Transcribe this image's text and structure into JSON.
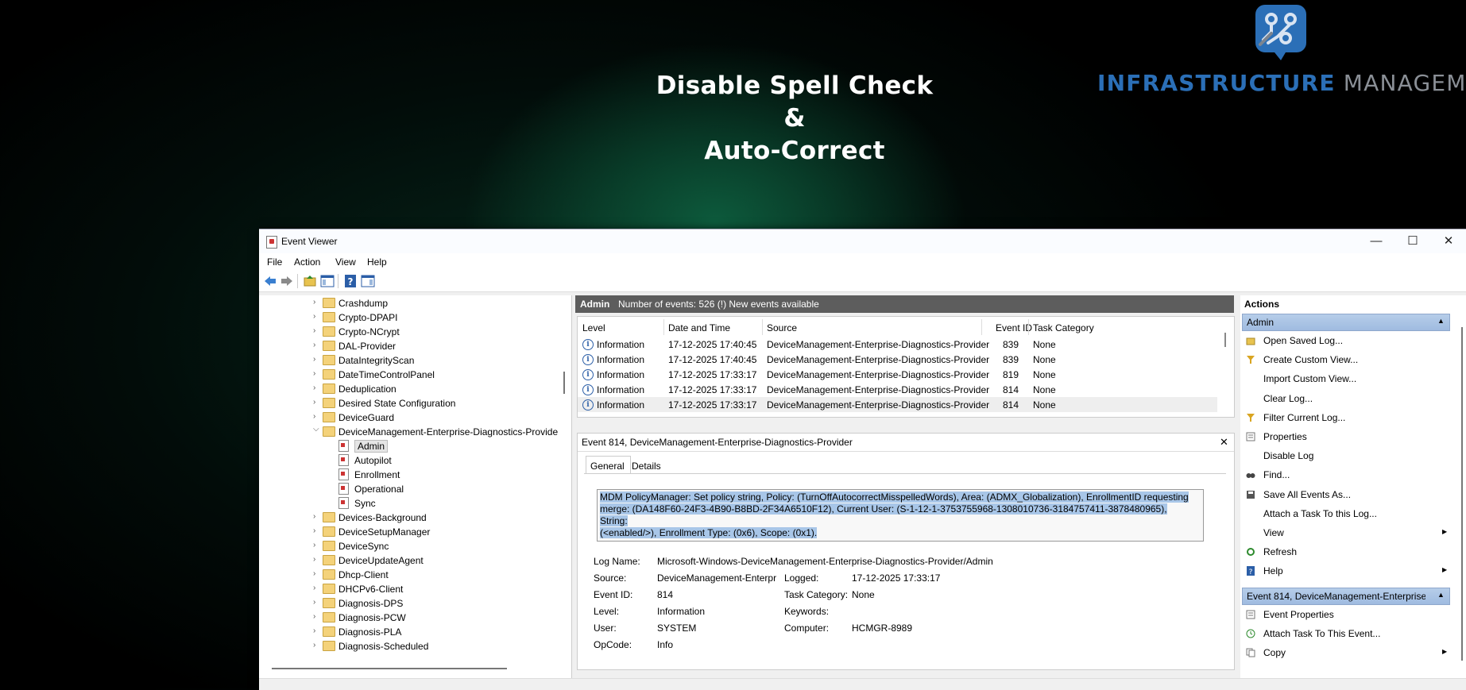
{
  "banner": {
    "headline_line1": "Disable Spell Check &",
    "headline_line2": "Auto-Correct",
    "logo_bold": "INFRASTRUCTURE",
    "logo_light": " MANAGEMENT",
    "logo_icon": "circuit-chat-bubble-icon"
  },
  "window": {
    "title": "Event Viewer",
    "menu": [
      "File",
      "Action",
      "View",
      "Help"
    ],
    "minimize": "—",
    "maximize": "☐",
    "close": "✕"
  },
  "tree": [
    {
      "label": "Crashdump",
      "type": "folder",
      "expanded": false
    },
    {
      "label": "Crypto-DPAPI",
      "type": "folder",
      "expanded": false
    },
    {
      "label": "Crypto-NCrypt",
      "type": "folder",
      "expanded": false
    },
    {
      "label": "DAL-Provider",
      "type": "folder",
      "expanded": false
    },
    {
      "label": "DataIntegrityScan",
      "type": "folder",
      "expanded": false
    },
    {
      "label": "DateTimeControlPanel",
      "type": "folder",
      "expanded": false
    },
    {
      "label": "Deduplication",
      "type": "folder",
      "expanded": false
    },
    {
      "label": "Desired State Configuration",
      "type": "folder",
      "expanded": false
    },
    {
      "label": "DeviceGuard",
      "type": "folder",
      "expanded": false
    },
    {
      "label": "DeviceManagement-Enterprise-Diagnostics-Provide",
      "type": "folder",
      "expanded": true
    },
    {
      "label": "Admin",
      "type": "log",
      "selected": true
    },
    {
      "label": "Autopilot",
      "type": "log"
    },
    {
      "label": "Enrollment",
      "type": "log"
    },
    {
      "label": "Operational",
      "type": "log"
    },
    {
      "label": "Sync",
      "type": "log"
    },
    {
      "label": "Devices-Background",
      "type": "folder",
      "expanded": false
    },
    {
      "label": "DeviceSetupManager",
      "type": "folder",
      "expanded": false
    },
    {
      "label": "DeviceSync",
      "type": "folder",
      "expanded": false
    },
    {
      "label": "DeviceUpdateAgent",
      "type": "folder",
      "expanded": false
    },
    {
      "label": "Dhcp-Client",
      "type": "folder",
      "expanded": false
    },
    {
      "label": "DHCPv6-Client",
      "type": "folder",
      "expanded": false
    },
    {
      "label": "Diagnosis-DPS",
      "type": "folder",
      "expanded": false
    },
    {
      "label": "Diagnosis-PCW",
      "type": "folder",
      "expanded": false
    },
    {
      "label": "Diagnosis-PLA",
      "type": "folder",
      "expanded": false
    },
    {
      "label": "Diagnosis-Scheduled",
      "type": "folder",
      "expanded": false
    }
  ],
  "log_header": {
    "name": "Admin",
    "summary": "Number of events: 526 (!) New events available"
  },
  "events_table": {
    "columns": [
      "Level",
      "Date and Time",
      "Source",
      "Event ID",
      "Task Category"
    ],
    "rows": [
      [
        "Information",
        "17-12-2025 17:40:45",
        "DeviceManagement-Enterprise-Diagnostics-Provider",
        "839",
        "None"
      ],
      [
        "Information",
        "17-12-2025 17:40:45",
        "DeviceManagement-Enterprise-Diagnostics-Provider",
        "839",
        "None"
      ],
      [
        "Information",
        "17-12-2025 17:33:17",
        "DeviceManagement-Enterprise-Diagnostics-Provider",
        "819",
        "None"
      ],
      [
        "Information",
        "17-12-2025 17:33:17",
        "DeviceManagement-Enterprise-Diagnostics-Provider",
        "814",
        "None"
      ],
      [
        "Information",
        "17-12-2025 17:33:17",
        "DeviceManagement-Enterprise-Diagnostics-Provider",
        "814",
        "None"
      ]
    ]
  },
  "detail": {
    "title": "Event 814, DeviceManagement-Enterprise-Diagnostics-Provider",
    "close": "✕",
    "tabs": [
      "General",
      "Details"
    ],
    "message_lines": [
      "MDM PolicyManager: Set policy string, Policy: (TurnOffAutocorrectMisspelledWords), Area: (ADMX_Globalization), EnrollmentID requesting",
      "merge: (DA148F60-24F3-4B90-B8BD-2F34A6510F12), Current User: (S-1-12-1-3753755968-1308010736-3184757411-3878480965), String:",
      "(<enabled/>), Enrollment Type: (0x6), Scope: (0x1)."
    ],
    "log_name_label": "Log Name:",
    "log_name": "Microsoft-Windows-DeviceManagement-Enterprise-Diagnostics-Provider/Admin",
    "source_label": "Source:",
    "source": "DeviceManagement-Enterpr",
    "logged_label": "Logged:",
    "logged": "17-12-2025 17:33:17",
    "event_id_label": "Event ID:",
    "event_id": "814",
    "task_category_label": "Task Category:",
    "task_category": "None",
    "level_label": "Level:",
    "level": "Information",
    "keywords_label": "Keywords:",
    "keywords": "",
    "user_label": "User:",
    "user": "SYSTEM",
    "computer_label": "Computer:",
    "computer": "HCMGR-8989",
    "opcode_label": "OpCode:",
    "opcode": "Info"
  },
  "actions": {
    "title": "Actions",
    "section1": "Admin",
    "items1": [
      {
        "label": "Open Saved Log...",
        "icon": "folder-open-icon"
      },
      {
        "label": "Create Custom View...",
        "icon": "filter-icon"
      },
      {
        "label": "Import Custom View...",
        "icon": ""
      },
      {
        "label": "Clear Log...",
        "icon": ""
      },
      {
        "label": "Filter Current Log...",
        "icon": "filter-icon"
      },
      {
        "label": "Properties",
        "icon": "properties-icon"
      },
      {
        "label": "Disable Log",
        "icon": ""
      },
      {
        "label": "Find...",
        "icon": "binoculars-icon"
      },
      {
        "label": "Save All Events As...",
        "icon": "save-icon"
      },
      {
        "label": "Attach a Task To this Log...",
        "icon": ""
      },
      {
        "label": "View",
        "icon": "",
        "submenu": true
      },
      {
        "label": "Refresh",
        "icon": "refresh-icon"
      },
      {
        "label": "Help",
        "icon": "help-icon",
        "submenu": true
      }
    ],
    "section2": "Event 814, DeviceManagement-Enterprise-...",
    "items2": [
      {
        "label": "Event Properties",
        "icon": "properties-icon"
      },
      {
        "label": "Attach Task To This Event...",
        "icon": "task-icon"
      },
      {
        "label": "Copy",
        "icon": "copy-icon",
        "submenu": true
      }
    ]
  }
}
